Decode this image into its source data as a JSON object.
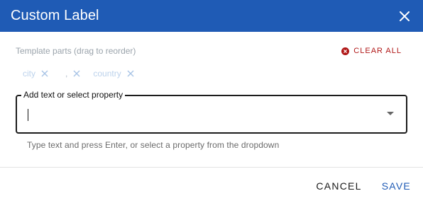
{
  "dialog": {
    "title": "Custom Label"
  },
  "template_parts": {
    "label": "Template parts (drag to reorder)",
    "clear_all_label": "CLEAR ALL",
    "chips": [
      {
        "label": "city"
      },
      {
        "label": ","
      },
      {
        "label": "country"
      }
    ]
  },
  "input": {
    "label": "Add text or select property",
    "value": "",
    "helper_text": "Type text and press Enter, or select a property from the dropdown"
  },
  "footer": {
    "cancel_label": "CANCEL",
    "save_label": "SAVE"
  },
  "colors": {
    "header_bg": "#1f5bb5",
    "accent": "#1f5bb5",
    "danger": "#b01717"
  },
  "icons": {
    "close": "close-icon",
    "clear": "clear-circle-icon",
    "chip_remove": "close-icon",
    "dropdown": "chevron-down-icon"
  }
}
